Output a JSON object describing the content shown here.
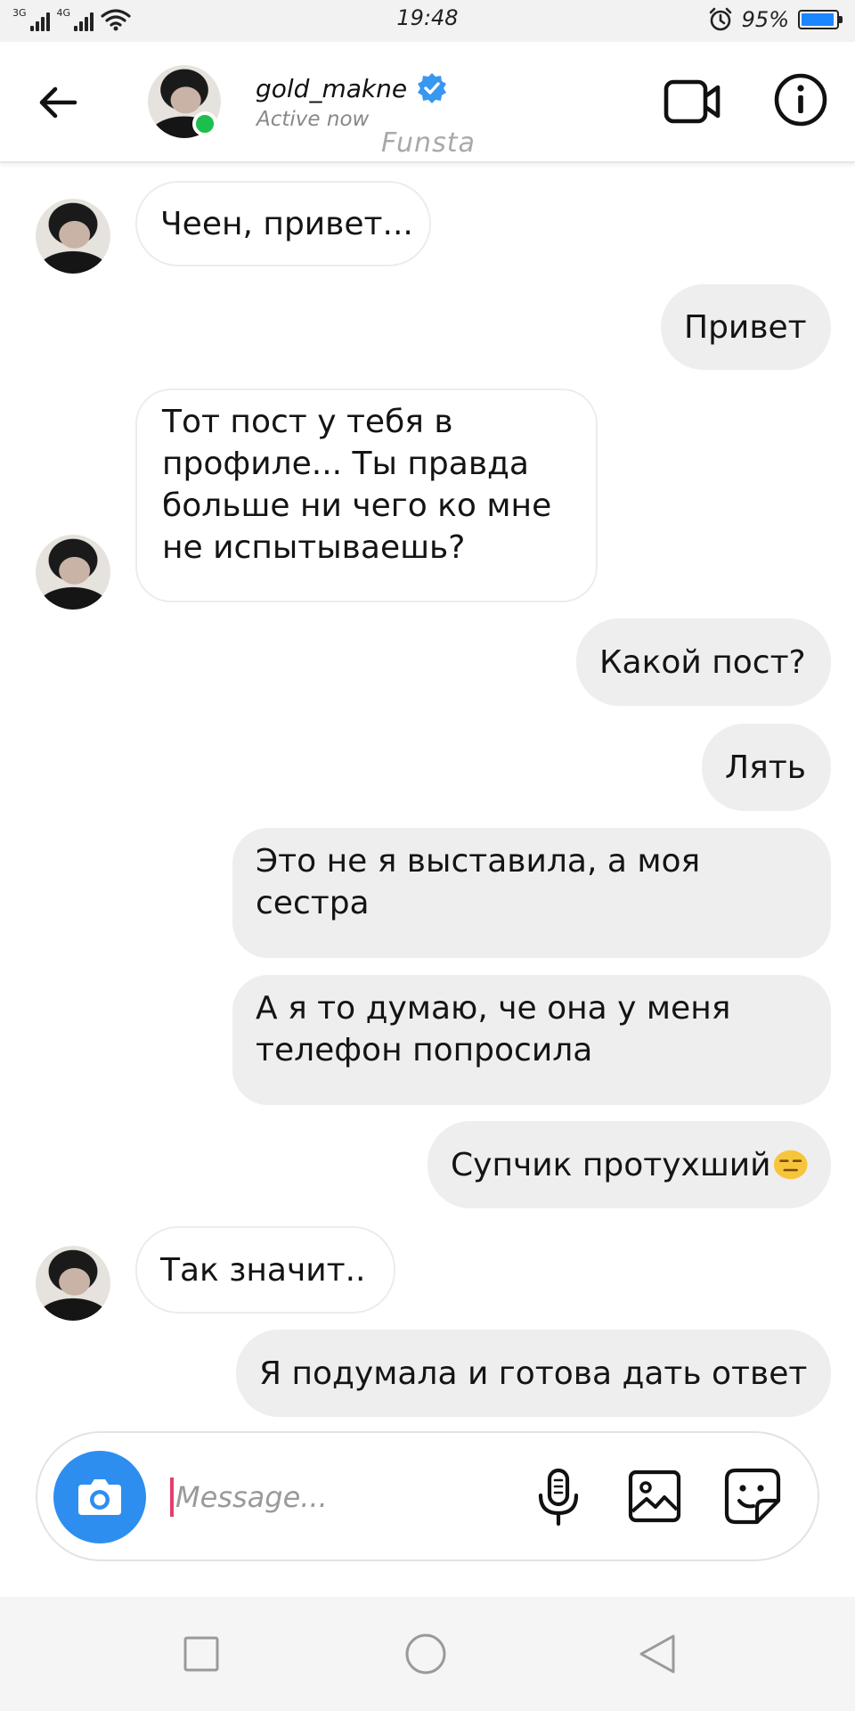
{
  "status_bar": {
    "network_1": "3G",
    "network_2": "4G",
    "time": "19:48",
    "battery_percent": "95%",
    "battery_level": 0.95
  },
  "header": {
    "username": "gold_makne",
    "verified": true,
    "status": "Active now",
    "account_label": "Funsta",
    "icons": [
      "back-arrow-icon",
      "video-call-icon",
      "info-icon"
    ]
  },
  "messages": [
    {
      "from": "them",
      "lines": [
        "Чеен, привет..."
      ]
    },
    {
      "from": "me",
      "lines": [
        "Привет"
      ]
    },
    {
      "from": "them",
      "lines": [
        "Тот пост у тебя в",
        "профиле... Ты правда",
        "больше ни чего ко мне",
        "не испытываешь?"
      ]
    },
    {
      "from": "me",
      "lines": [
        "Какой пост?"
      ]
    },
    {
      "from": "me",
      "lines": [
        "Лять"
      ]
    },
    {
      "from": "me",
      "lines": [
        "Это не я выставила, а моя",
        "сестра"
      ]
    },
    {
      "from": "me",
      "lines": [
        "А я то думаю, че она у меня",
        "телефон попросила"
      ]
    },
    {
      "from": "me",
      "lines": [
        "Супчик протухший"
      ],
      "emoji": "expressionless-face"
    },
    {
      "from": "them",
      "lines": [
        "Так значит.."
      ]
    },
    {
      "from": "me",
      "lines": [
        "Я подумала и готова дать ответ"
      ]
    }
  ],
  "composer": {
    "placeholder": "Message...",
    "value": "",
    "icons": [
      "camera-icon",
      "microphone-icon",
      "gallery-icon",
      "sticker-icon"
    ]
  },
  "nav_bar": {
    "icons": [
      "recent-apps-icon",
      "home-icon",
      "back-icon"
    ]
  },
  "colors": {
    "accent_blue": "#2d8ef0",
    "verified_blue": "#3897f0",
    "online_green": "#1dbf4c",
    "outgoing_bubble": "#eeeeef",
    "battery_blue": "#1a86ff"
  }
}
